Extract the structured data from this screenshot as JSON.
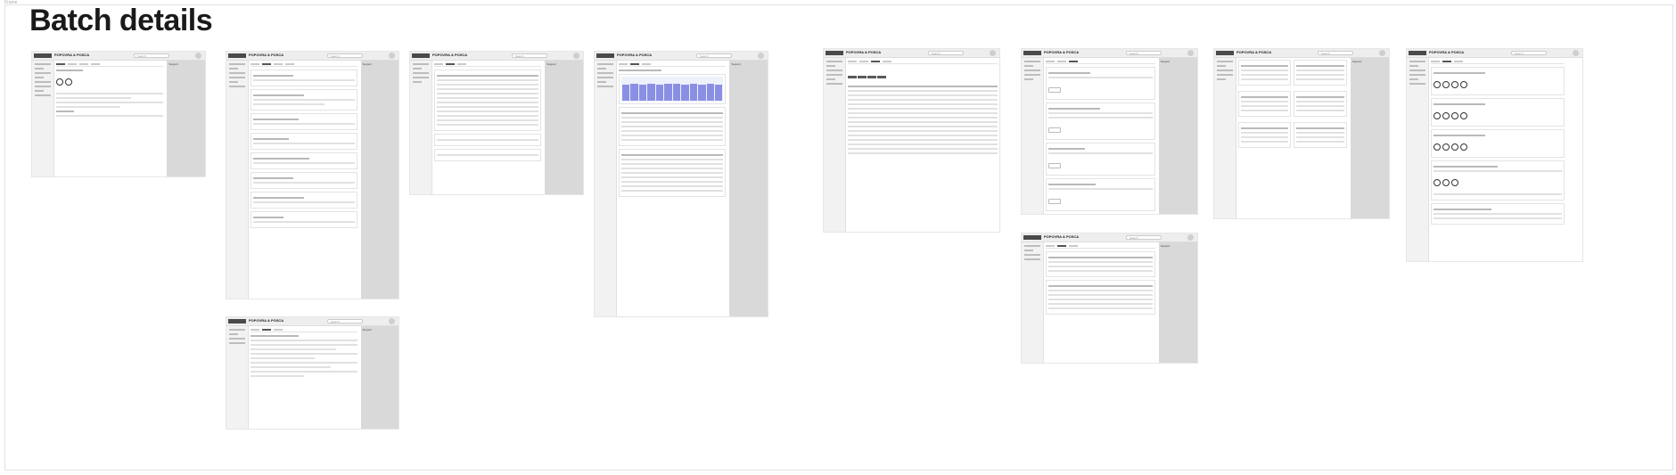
{
  "page": {
    "title": "Batch details",
    "board_tag": "Frame"
  },
  "app": {
    "name": "POPOVRA & POSCA",
    "search_placeholder": "Search",
    "side_panel_label": "Support"
  }
}
